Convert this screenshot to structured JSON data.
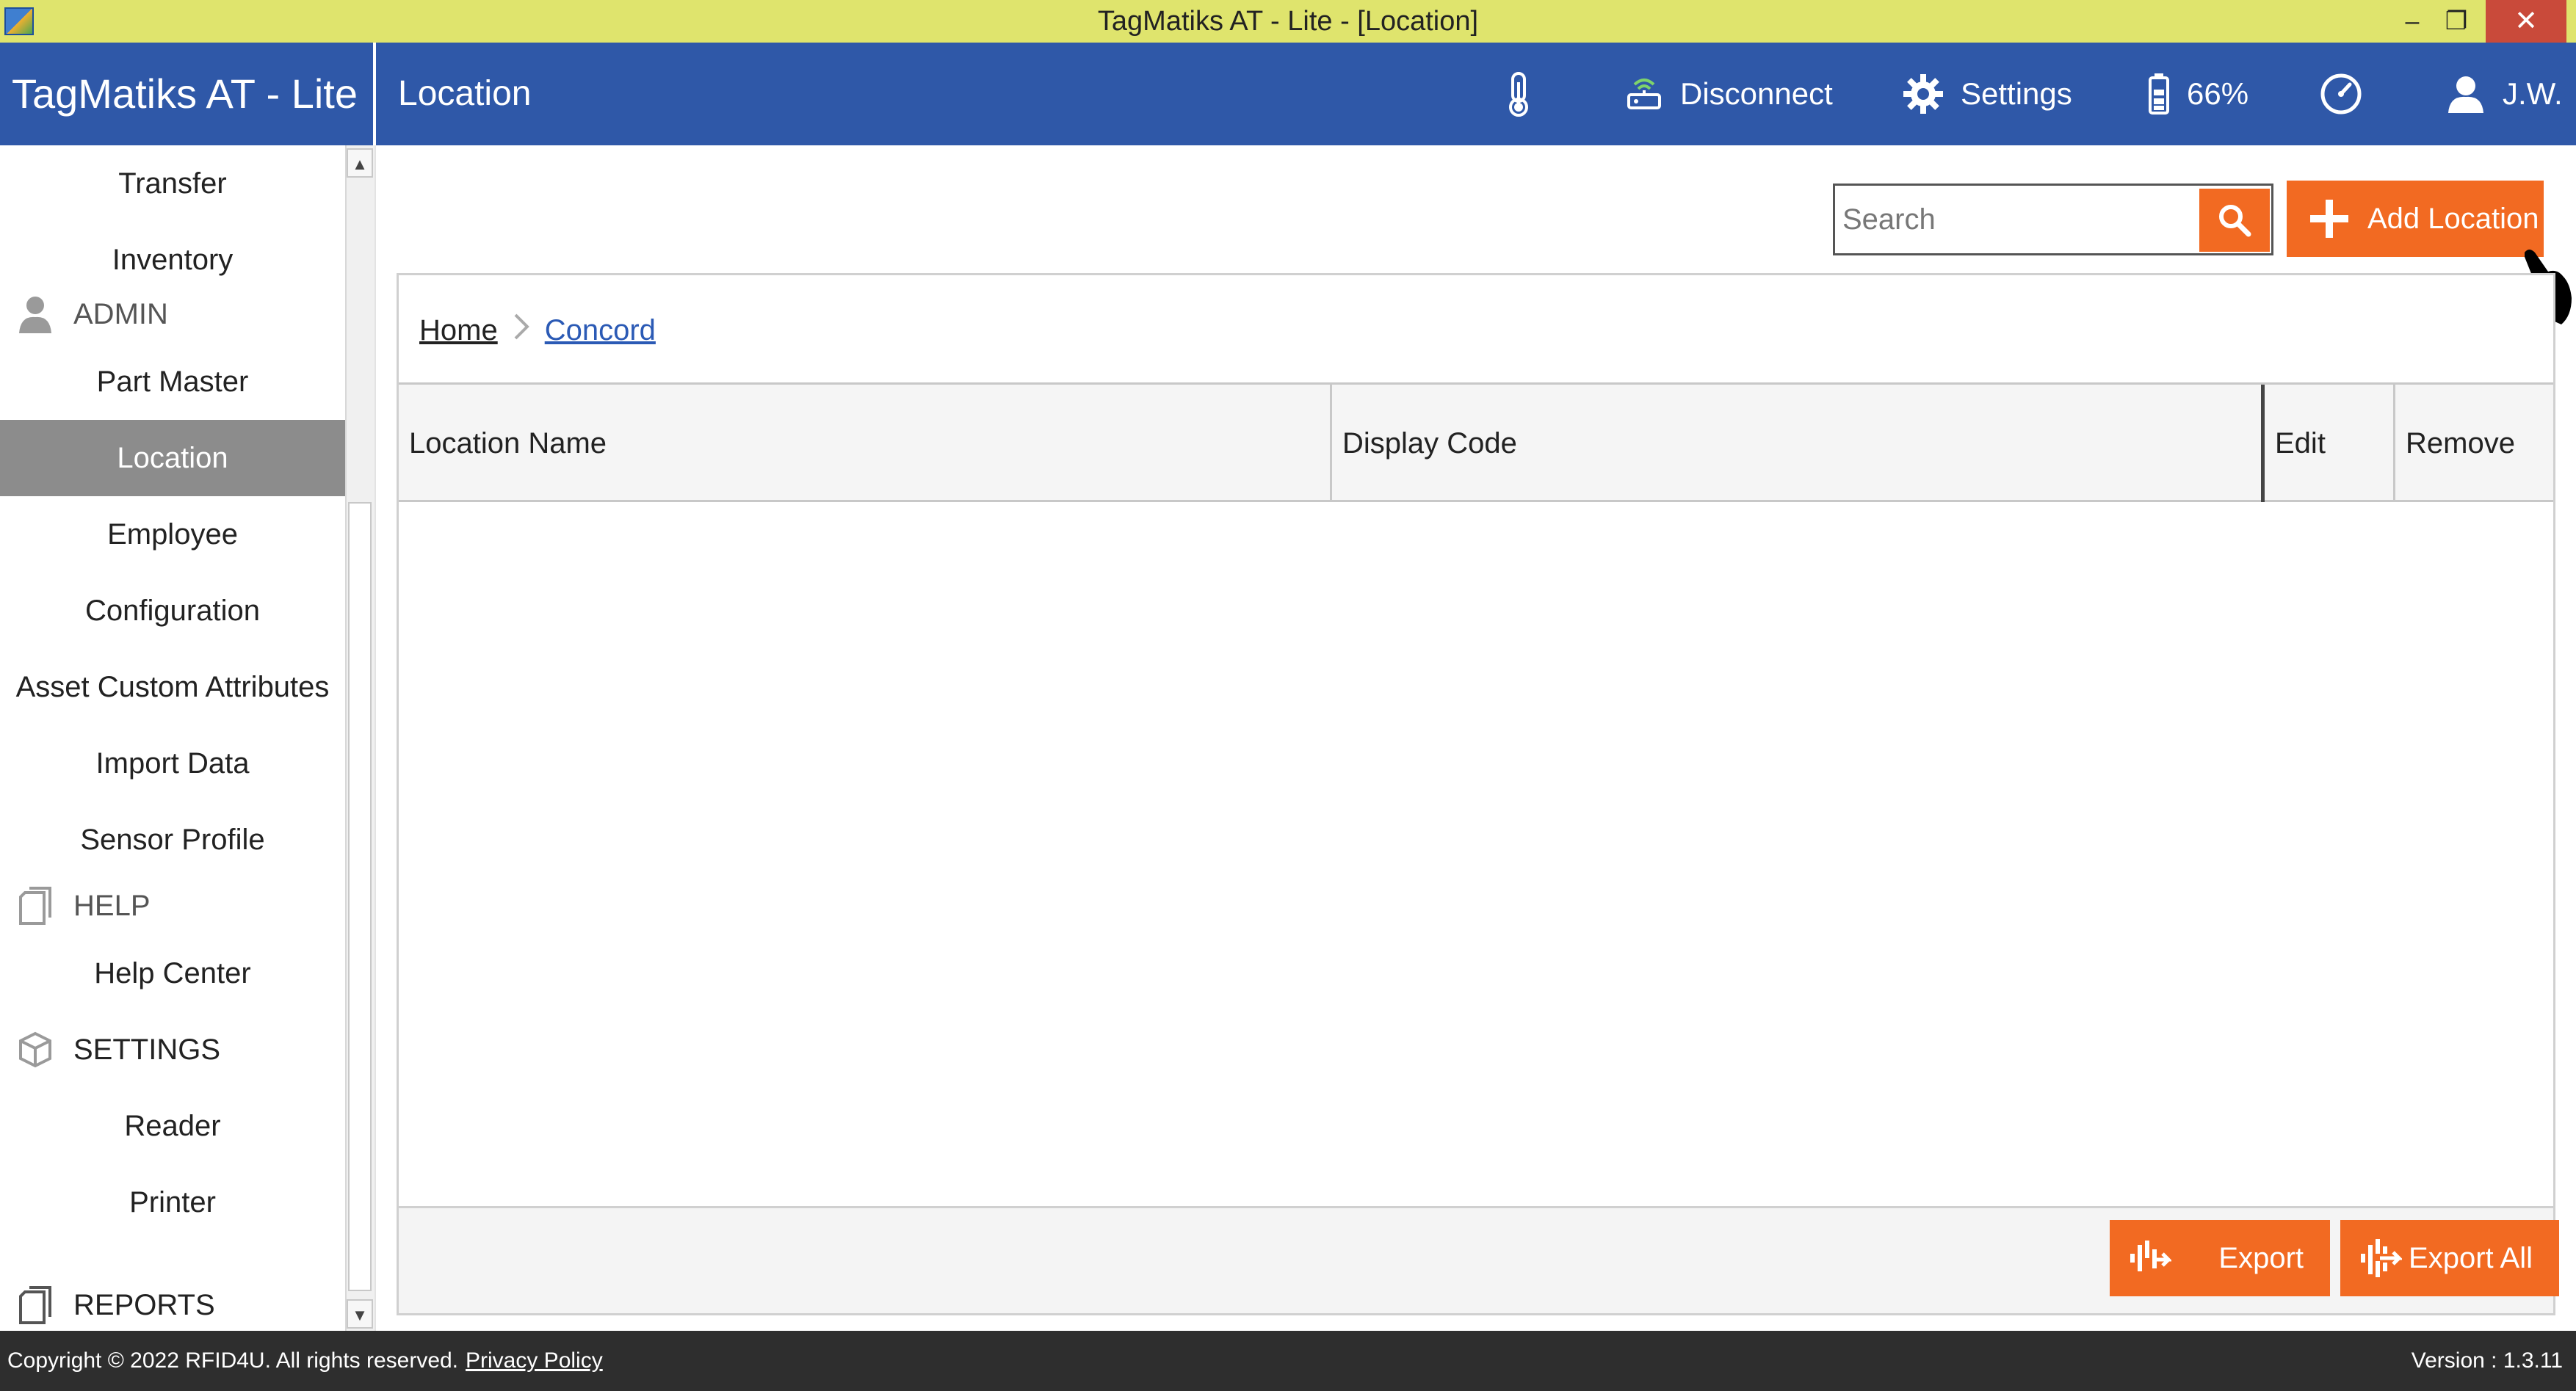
{
  "window": {
    "title": "TagMatiks AT - Lite - [Location]",
    "minimize": "–",
    "maximize": "❐",
    "close": "✕"
  },
  "header": {
    "brand": "TagMatiks AT - Lite",
    "page_title": "Location",
    "disconnect_label": "Disconnect",
    "settings_label": "Settings",
    "battery_label": "66%",
    "user_label": "J.W."
  },
  "sidebar": {
    "items": [
      {
        "label": "Transfer"
      },
      {
        "label": "Inventory"
      },
      {
        "label": "Part Master"
      },
      {
        "label": "Location",
        "active": true
      },
      {
        "label": "Employee"
      },
      {
        "label": "Configuration"
      },
      {
        "label": "Asset Custom Attributes"
      },
      {
        "label": "Import Data"
      },
      {
        "label": "Sensor Profile"
      },
      {
        "label": "Help Center"
      },
      {
        "label": "Reader"
      },
      {
        "label": "Printer"
      }
    ],
    "sections": {
      "admin": "ADMIN",
      "help": "HELP",
      "settings": "SETTINGS",
      "reports": "REPORTS"
    }
  },
  "toolbar": {
    "search_placeholder": "Search",
    "search_value": "",
    "add_label": "Add Location"
  },
  "breadcrumb": {
    "home": "Home",
    "current": "Concord"
  },
  "table": {
    "columns": [
      "Location Name",
      "Display Code",
      "Edit",
      "Remove"
    ],
    "rows": []
  },
  "footer_buttons": {
    "export": "Export",
    "export_all": "Export All"
  },
  "statusbar": {
    "copyright": "Copyright © 2022 RFID4U. All rights reserved.",
    "privacy": "Privacy Policy",
    "version": "Version : 1.3.11"
  },
  "colors": {
    "title_bar": "#dfe46d",
    "header": "#2f58a8",
    "accent": "#f26a22",
    "active_nav": "#8c8c8c",
    "status_bar": "#2e2e2e"
  }
}
